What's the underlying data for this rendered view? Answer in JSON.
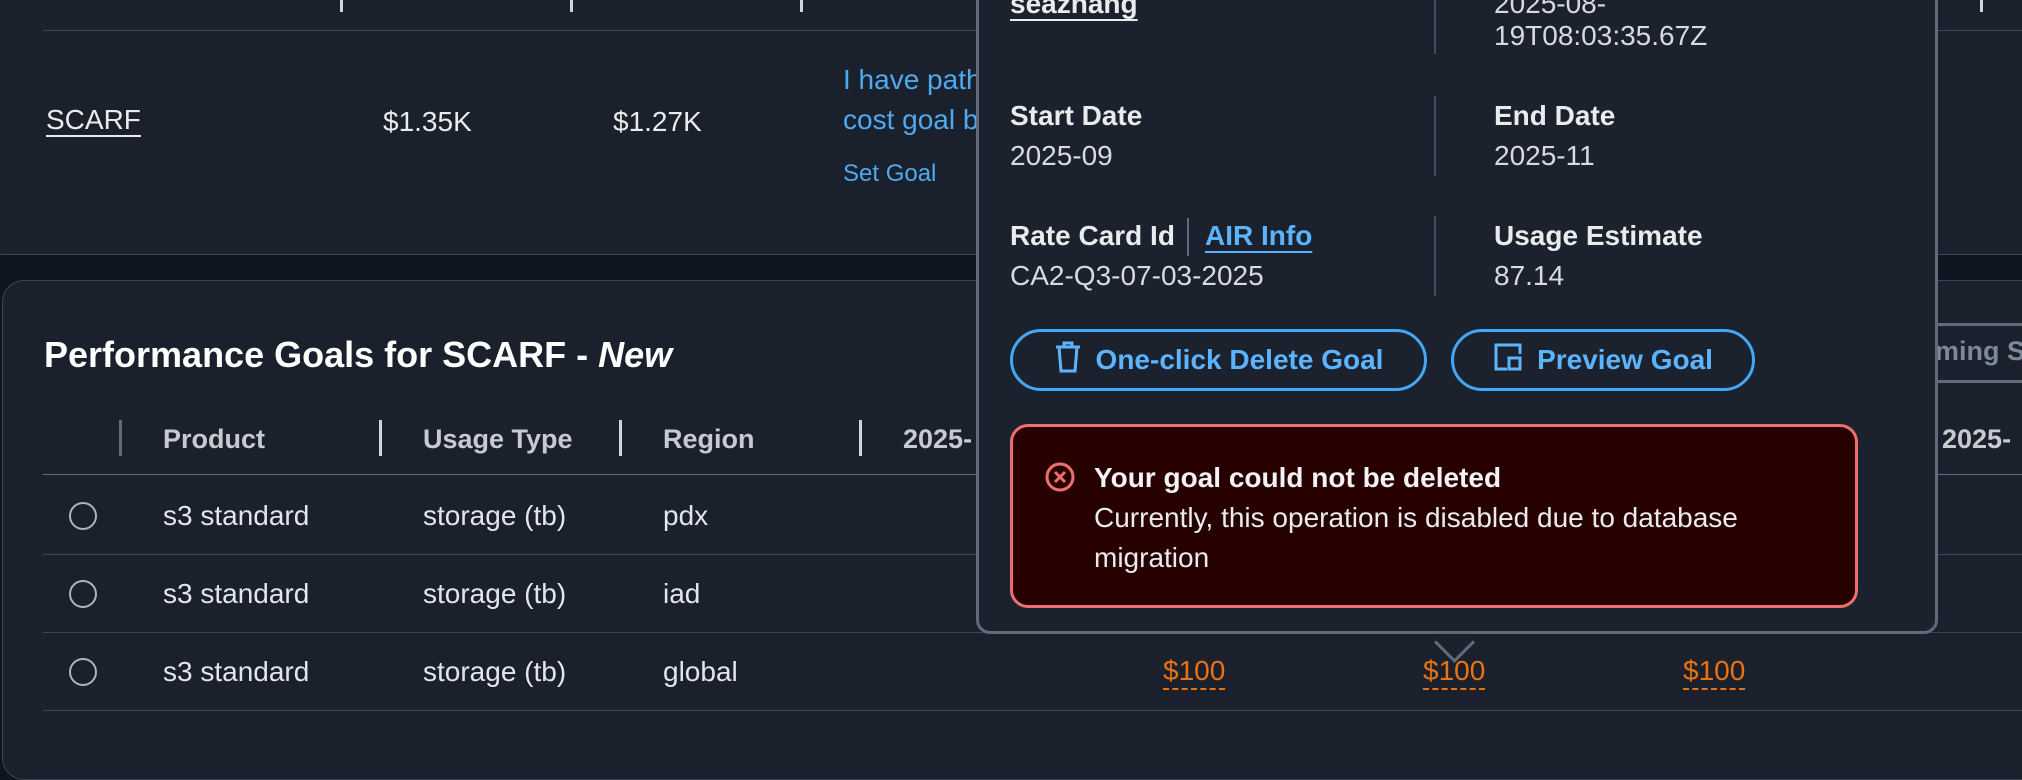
{
  "top_row": {
    "name": "SCARF",
    "value_a": "$1.35K",
    "value_b": "$1.27K",
    "note_line1": "I have path",
    "note_line2": "cost goal b",
    "set_goal": "Set Goal"
  },
  "goals": {
    "title_main": "Performance Goals for SCARF - ",
    "title_new": "New",
    "upcoming_label": "ming S",
    "columns": [
      "Product",
      "Usage Type",
      "Region",
      "2025-",
      "2025-"
    ],
    "rows": [
      {
        "product": "s3 standard",
        "usage_type": "storage (tb)",
        "region": "pdx",
        "amounts": []
      },
      {
        "product": "s3 standard",
        "usage_type": "storage (tb)",
        "region": "iad",
        "amounts": []
      },
      {
        "product": "s3 standard",
        "usage_type": "storage (tb)",
        "region": "global",
        "amounts": [
          "$100",
          "$100",
          "$100"
        ]
      }
    ]
  },
  "popover": {
    "owner_link": "seazhang",
    "created_line1": "2025-08-",
    "created_line2": "19T08:03:35.67Z",
    "start_date_label": "Start Date",
    "start_date": "2025-09",
    "end_date_label": "End Date",
    "end_date": "2025-11",
    "rate_card_label": "Rate Card Id",
    "air_info": "AIR Info",
    "rate_card": "CA2-Q3-07-03-2025",
    "usage_label": "Usage Estimate",
    "usage": "87.14",
    "delete_button": "One-click Delete Goal",
    "preview_button": "Preview Goal",
    "alert_title": "Your goal could not be deleted",
    "alert_line1": "Currently, this operation is disabled due to database",
    "alert_line2": "migration"
  },
  "colors": {
    "accent": "#42a8f4",
    "amount": "#ec7211",
    "error": "#f06e6e"
  }
}
